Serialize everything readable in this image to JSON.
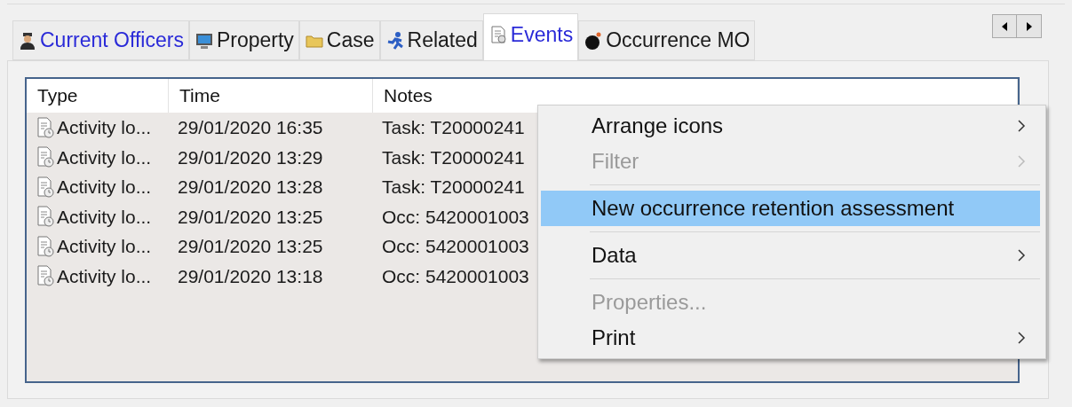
{
  "tabs": [
    {
      "label": "Current Officers",
      "selected": false,
      "highlighted": true
    },
    {
      "label": "Property",
      "selected": false,
      "highlighted": false
    },
    {
      "label": "Case",
      "selected": false,
      "highlighted": false
    },
    {
      "label": "Related",
      "selected": false,
      "highlighted": false
    },
    {
      "label": "Events",
      "selected": true,
      "highlighted": true
    },
    {
      "label": "Occurrence MO",
      "selected": false,
      "highlighted": false
    }
  ],
  "table": {
    "columns": [
      "Type",
      "Time",
      "Notes"
    ],
    "rows": [
      [
        "Activity lo...",
        "29/01/2020 16:35",
        "Task: T20000241"
      ],
      [
        "Activity lo...",
        "29/01/2020 13:29",
        "Task: T20000241"
      ],
      [
        "Activity lo...",
        "29/01/2020 13:28",
        "Task: T20000241"
      ],
      [
        "Activity lo...",
        "29/01/2020 13:25",
        "Occ: 5420001003"
      ],
      [
        "Activity lo...",
        "29/01/2020 13:25",
        "Occ: 5420001003"
      ],
      [
        "Activity lo...",
        "29/01/2020 13:18",
        "Occ: 5420001003"
      ]
    ]
  },
  "context_menu": [
    {
      "kind": "item",
      "label": "Arrange icons",
      "disabled": false,
      "submenu": true,
      "selected": false
    },
    {
      "kind": "item",
      "label": "Filter",
      "disabled": true,
      "submenu": true,
      "selected": false
    },
    {
      "kind": "separator"
    },
    {
      "kind": "item",
      "label": "New occurrence retention assessment",
      "disabled": false,
      "submenu": false,
      "selected": true
    },
    {
      "kind": "separator"
    },
    {
      "kind": "item",
      "label": "Data",
      "disabled": false,
      "submenu": true,
      "selected": false
    },
    {
      "kind": "separator"
    },
    {
      "kind": "item",
      "label": "Properties...",
      "disabled": true,
      "submenu": false,
      "selected": false
    },
    {
      "kind": "item",
      "label": "Print",
      "disabled": false,
      "submenu": true,
      "selected": false
    }
  ]
}
